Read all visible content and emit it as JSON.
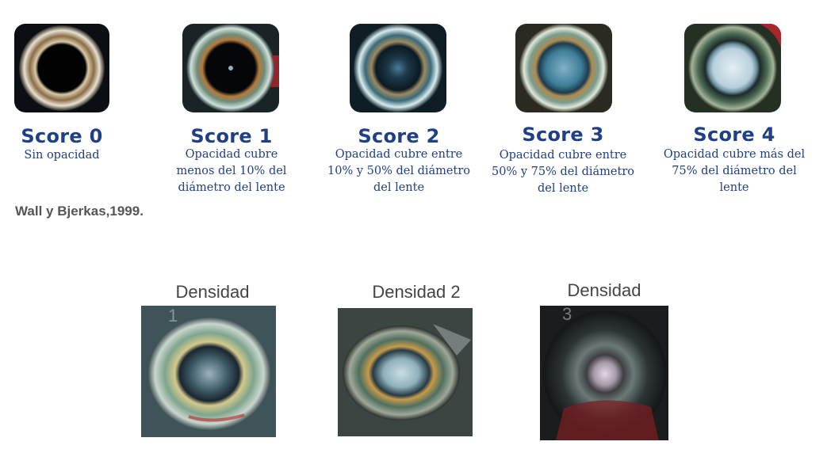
{
  "scores": [
    {
      "title": "Score 0",
      "description_lines": [
        "Sin opacidad"
      ],
      "image_icon": "fish-eye-clear-lens-image"
    },
    {
      "title": "Score 1",
      "description_lines": [
        "Opacidad cubre",
        "menos del 10% del",
        "diámetro del lente"
      ],
      "image_icon": "fish-eye-small-opacity-image"
    },
    {
      "title": "Score 2",
      "description_lines": [
        "Opacidad cubre entre",
        "10% y 50% del diámetro",
        "del lente"
      ],
      "image_icon": "fish-eye-medium-opacity-image"
    },
    {
      "title": "Score 3",
      "description_lines": [
        "Opacidad cubre entre",
        "50% y 75% del diámetro",
        "del lente"
      ],
      "image_icon": "fish-eye-large-opacity-image"
    },
    {
      "title": "Score 4",
      "description_lines": [
        "Opacidad cubre más del",
        "75% del diámetro del",
        "lente"
      ],
      "image_icon": "fish-eye-full-opacity-image"
    }
  ],
  "citation": "Wall y Bjerkas,1999.",
  "densities": [
    {
      "label": "Densidad",
      "photo_number": "1",
      "image_icon": "fish-eye-density-1-photo"
    },
    {
      "label": "Densidad 2",
      "photo_number": "2",
      "image_icon": "fish-eye-density-2-photo"
    },
    {
      "label": "Densidad",
      "photo_number": "3",
      "image_icon": "fish-eye-density-3-photo"
    }
  ],
  "colors": {
    "score_text": "#1f3f86",
    "citation_text": "#555555",
    "density_label": "#444444"
  }
}
